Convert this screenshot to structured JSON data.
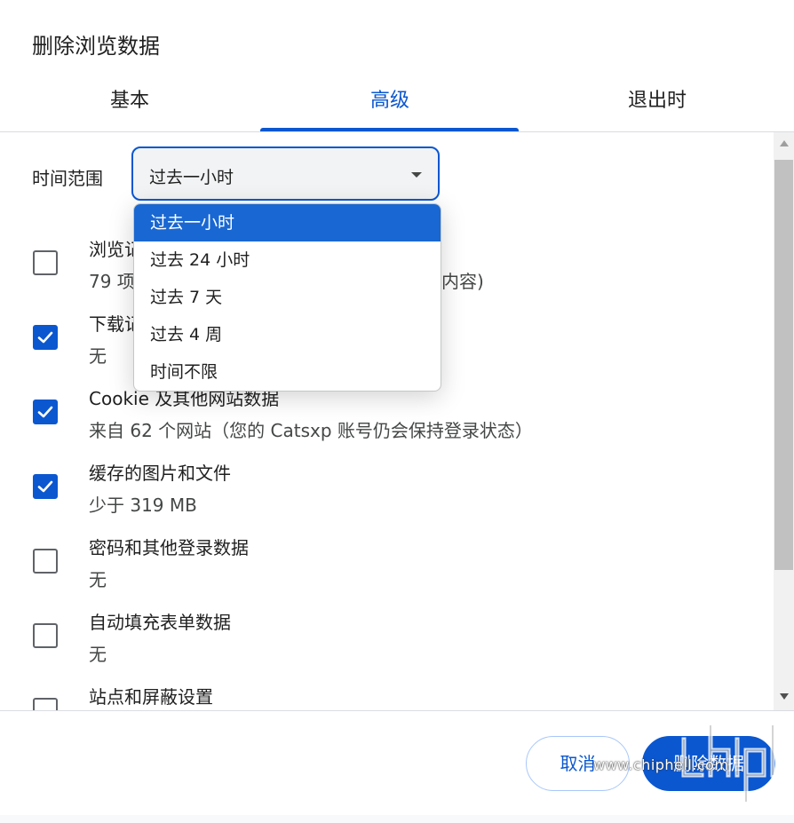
{
  "dialog": {
    "title": "删除浏览数据"
  },
  "tabs": [
    {
      "label": "基本",
      "active": false
    },
    {
      "label": "高级",
      "active": true
    },
    {
      "label": "退出时",
      "active": false
    }
  ],
  "time_range": {
    "label": "时间范围",
    "selected": "过去一小时"
  },
  "dropdown": {
    "options": [
      "过去一小时",
      "过去 24 小时",
      "过去 7 天",
      "过去 4 周",
      "时间不限"
    ],
    "selected_index": 0
  },
  "items": [
    {
      "label": "浏览记",
      "sub": "79 项",
      "sub_tail": "内容)",
      "checked": false
    },
    {
      "label": "下载记",
      "sub": "无",
      "checked": true
    },
    {
      "label": "Cookie 及其他网站数据",
      "sub": "来自 62 个网站（您的 Catsxp 账号仍会保持登录状态）",
      "checked": true
    },
    {
      "label": "缓存的图片和文件",
      "sub": "少于 319 MB",
      "checked": true
    },
    {
      "label": "密码和其他登录数据",
      "sub": "无",
      "checked": false
    },
    {
      "label": "自动填充表单数据",
      "sub": "无",
      "checked": false
    },
    {
      "label": "站点和屏蔽设置",
      "checked": false
    }
  ],
  "buttons": {
    "cancel": "取消",
    "confirm": "删除数据"
  },
  "watermark": {
    "url": "www.chiphell.com"
  },
  "colors": {
    "accent": "#0b57d0",
    "selected_option": "#1967d2"
  },
  "icons": {
    "checkbox_checked": "check-icon",
    "dropdown": "caret-down-icon"
  }
}
